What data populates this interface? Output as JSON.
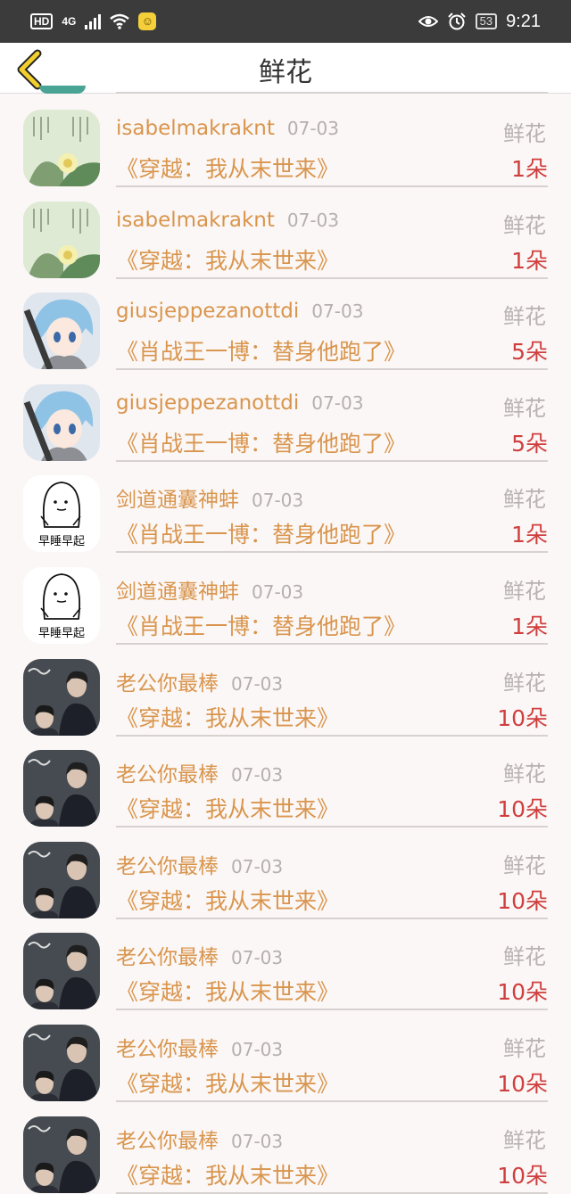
{
  "status_bar": {
    "hd": "HD",
    "network": "4G",
    "battery": "53",
    "time": "9:21"
  },
  "header": {
    "title": "鲜花"
  },
  "rows": [
    {
      "name": "isabelmakraknt",
      "date": "07-03",
      "label": "鲜花",
      "book": "《穿越：我从末世来》",
      "count": "1朵",
      "avatar": "ink-lotus"
    },
    {
      "name": "isabelmakraknt",
      "date": "07-03",
      "label": "鲜花",
      "book": "《穿越：我从末世来》",
      "count": "1朵",
      "avatar": "ink-lotus"
    },
    {
      "name": "giusjeppezanottdi",
      "date": "07-03",
      "label": "鲜花",
      "book": "《肖战王一博：替身他跑了》",
      "count": "5朵",
      "avatar": "anime-bluehair"
    },
    {
      "name": "giusjeppezanottdi",
      "date": "07-03",
      "label": "鲜花",
      "book": "《肖战王一博：替身他跑了》",
      "count": "5朵",
      "avatar": "anime-bluehair"
    },
    {
      "name": "剑道通囊神蚌",
      "date": "07-03",
      "label": "鲜花",
      "book": "《肖战王一博：替身他跑了》",
      "count": "1朵",
      "avatar": "sketch-ghost",
      "avatar_text": "早睡早起"
    },
    {
      "name": "剑道通囊神蚌",
      "date": "07-03",
      "label": "鲜花",
      "book": "《肖战王一博：替身他跑了》",
      "count": "1朵",
      "avatar": "sketch-ghost",
      "avatar_text": "早睡早起"
    },
    {
      "name": "老公你最棒",
      "date": "07-03",
      "label": "鲜花",
      "book": "《穿越：我从末世来》",
      "count": "10朵",
      "avatar": "photo-portrait"
    },
    {
      "name": "老公你最棒",
      "date": "07-03",
      "label": "鲜花",
      "book": "《穿越：我从末世来》",
      "count": "10朵",
      "avatar": "photo-portrait"
    },
    {
      "name": "老公你最棒",
      "date": "07-03",
      "label": "鲜花",
      "book": "《穿越：我从末世来》",
      "count": "10朵",
      "avatar": "photo-portrait"
    },
    {
      "name": "老公你最棒",
      "date": "07-03",
      "label": "鲜花",
      "book": "《穿越：我从末世来》",
      "count": "10朵",
      "avatar": "photo-portrait"
    },
    {
      "name": "老公你最棒",
      "date": "07-03",
      "label": "鲜花",
      "book": "《穿越：我从末世来》",
      "count": "10朵",
      "avatar": "photo-portrait"
    },
    {
      "name": "老公你最棒",
      "date": "07-03",
      "label": "鲜花",
      "book": "《穿越：我从末世来》",
      "count": "10朵",
      "avatar": "photo-portrait"
    }
  ],
  "colors": {
    "name": "#d9954d",
    "count": "#cf3f3f",
    "muted": "#b5b0ae",
    "background": "#fbf7f6"
  }
}
